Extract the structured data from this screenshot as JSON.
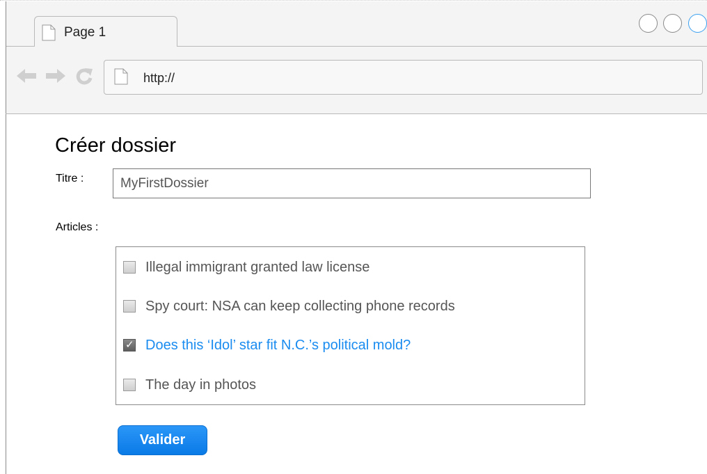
{
  "browser": {
    "tab": {
      "label": "Page 1",
      "icon": "page-icon"
    },
    "window_buttons": [
      "window-button-1",
      "window-button-2",
      "window-button-3"
    ],
    "nav": {
      "back_icon": "back-arrow-icon",
      "forward_icon": "forward-arrow-icon",
      "reload_icon": "reload-icon"
    },
    "address": {
      "value": "http://"
    }
  },
  "form": {
    "heading": "Créer dossier",
    "title_label": "Titre :",
    "title_value": "MyFirstDossier",
    "articles_label": "Articles :",
    "articles": [
      {
        "label": "Illegal immigrant granted law license",
        "checked": false
      },
      {
        "label": "Spy court: NSA can keep collecting phone records",
        "checked": false
      },
      {
        "label": "Does this ‘Idol’ star fit N.C.’s political mold?",
        "checked": true
      },
      {
        "label": "The day in photos",
        "checked": false
      }
    ],
    "submit_label": "Valider"
  },
  "colors": {
    "accent": "#1a8cf0",
    "button": "#0a7ae6",
    "window_button_active": "#3aa0f0"
  }
}
